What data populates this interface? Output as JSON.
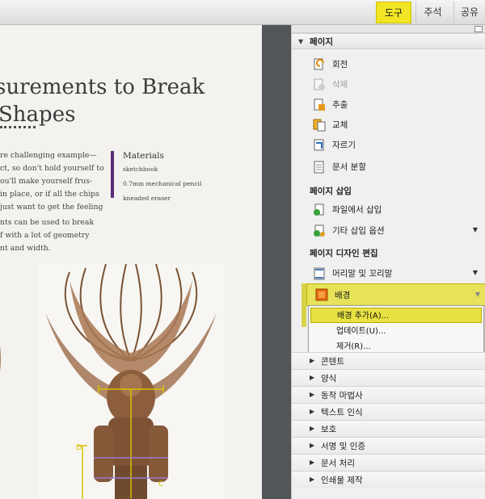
{
  "tabs": [
    {
      "label": "도구"
    },
    {
      "label": "주석"
    },
    {
      "label": "공유"
    }
  ],
  "document": {
    "heading_line1": "surements to Break",
    "heading_line2": "Shapes",
    "paragraph1": [
      "re challenging example—",
      "ct, so don't hold yourself to",
      "ou'll make yourself frus-",
      "in place, or if all the chips",
      "just want to get the feeling"
    ],
    "paragraph2": [
      "nts can be used to break",
      "f with a lot of geometry",
      "nt and width."
    ],
    "materials_title": "Materials",
    "materials_items": [
      "sketchbook",
      "0.7mm mechanical pencil",
      "kneaded eraser"
    ],
    "measure_labels": [
      "D",
      "C"
    ]
  },
  "panel": {
    "page_section": "페이지",
    "page_items": [
      {
        "label": "회전",
        "icon": "rotate-page-icon",
        "disabled": false
      },
      {
        "label": "삭제",
        "icon": "delete-page-icon",
        "disabled": true
      },
      {
        "label": "추출",
        "icon": "extract-page-icon",
        "disabled": false
      },
      {
        "label": "교체",
        "icon": "replace-page-icon",
        "disabled": false
      },
      {
        "label": "자르기",
        "icon": "crop-page-icon",
        "disabled": false
      },
      {
        "label": "문서 분할",
        "icon": "split-document-icon",
        "disabled": false
      }
    ],
    "insert_label": "페이지 삽입",
    "insert_items": [
      {
        "label": "파일에서 삽입",
        "icon": "insert-from-file-icon"
      },
      {
        "label": "기타 삽입 옵션",
        "icon": "more-insert-options-icon"
      }
    ],
    "design_label": "페이지 디자인 편집",
    "header_footer": "머리말 및 꼬리말",
    "background": "배경",
    "background_menu": [
      "배경 추가(A)...",
      "업데이트(U)...",
      "제거(R)..."
    ],
    "collapsed_sections": [
      "콘텐트",
      "양식",
      "동작 마법사",
      "텍스트 인식",
      "보호",
      "서명 및 인증",
      "문서 처리",
      "인쇄물 제작"
    ]
  },
  "colors": {
    "accent_yellow": "#f2e526",
    "materials_bar": "#5d2a78",
    "measure_lines": "#d8c200"
  }
}
